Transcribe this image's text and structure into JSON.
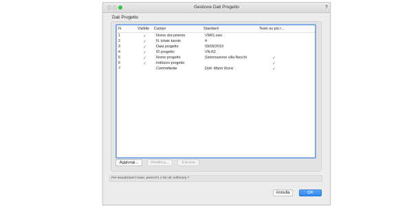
{
  "window": {
    "title": "Gestione Dati Progetto",
    "help_mark": "?"
  },
  "group": {
    "label": "Dati Progetto"
  },
  "table": {
    "headers": {
      "n": "N.",
      "visible": "Visibile",
      "field": "Campo",
      "standard": "Standard",
      "text_on_more": "Testo su più r..."
    },
    "rows": [
      {
        "n": "1",
        "visible": "✓",
        "field": "Nome documento",
        "standard": "VNR1.vwx",
        "more": ""
      },
      {
        "n": "2",
        "visible": "✓",
        "field": "N. totale tavole",
        "standard": "4",
        "more": ""
      },
      {
        "n": "3",
        "visible": "✓",
        "field": "Data progetto",
        "standard": "09/05/2019",
        "more": ""
      },
      {
        "n": "4",
        "visible": "✓",
        "field": "ID progetto",
        "standard": "VN-R1",
        "more": ""
      },
      {
        "n": "5",
        "visible": "✓",
        "field": "Nome progetto",
        "standard": "Sistemazione villa Necchi",
        "more": "✓"
      },
      {
        "n": "6",
        "visible": "✓",
        "field": "Indirizzo progetto",
        "standard": "",
        "more": "✓"
      },
      {
        "n": "7",
        "visible": "",
        "field": "Committente",
        "standard": "Dott. Mario Rossi",
        "more": "✓"
      }
    ]
  },
  "buttons": {
    "add": "Aggiungi...",
    "modify": "Modifica...",
    "delete": "Elimina"
  },
  "help_text": "Per visualizzare l'Aiuto, premi F1 o fai clic sull'icona ?",
  "footer": {
    "cancel": "Annulla",
    "ok": "OK"
  },
  "colors": {
    "accent": "#2f84f2",
    "selection_border": "#7fa9e6"
  }
}
